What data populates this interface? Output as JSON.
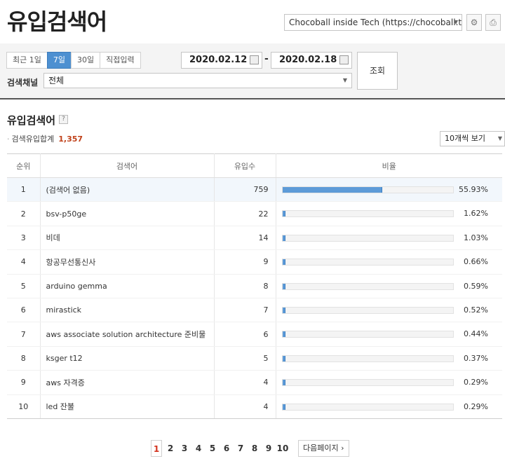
{
  "page": {
    "title": "유입검색어",
    "blog_select": "Chocoball inside Tech (https://chocoball.t⋯",
    "settings_icon": "gear-icon",
    "print_icon": "print-icon"
  },
  "filters": {
    "periods": [
      "최근 1일",
      "7일",
      "30일",
      "직접입력"
    ],
    "active_period": "7일",
    "start_date": "2020.02.12",
    "date_separator": "-",
    "end_date": "2020.02.18",
    "search_label": "조회",
    "channel_label": "검색채널",
    "channel_value": "전체"
  },
  "section": {
    "title": "유입검색어",
    "help": "?",
    "summary_label": "검색유입합계",
    "summary_total": "1,357",
    "per_page": "10개씩 보기"
  },
  "table": {
    "headers": [
      "순위",
      "검색어",
      "유입수",
      "비율"
    ],
    "rows": [
      {
        "rank": "1",
        "term": "(검색어 없음)",
        "count": "759",
        "pct_label": "55.93%",
        "pct": 55.93
      },
      {
        "rank": "2",
        "term": "bsv-p50ge",
        "count": "22",
        "pct_label": "1.62%",
        "pct": 1.62
      },
      {
        "rank": "3",
        "term": "비데",
        "count": "14",
        "pct_label": "1.03%",
        "pct": 1.03
      },
      {
        "rank": "4",
        "term": "항공무선통신사",
        "count": "9",
        "pct_label": "0.66%",
        "pct": 0.66
      },
      {
        "rank": "5",
        "term": "arduino gemma",
        "count": "8",
        "pct_label": "0.59%",
        "pct": 0.59
      },
      {
        "rank": "6",
        "term": "mirastick",
        "count": "7",
        "pct_label": "0.52%",
        "pct": 0.52
      },
      {
        "rank": "7",
        "term": "aws associate solution architecture 준비물",
        "count": "6",
        "pct_label": "0.44%",
        "pct": 0.44
      },
      {
        "rank": "8",
        "term": "ksger t12",
        "count": "5",
        "pct_label": "0.37%",
        "pct": 0.37
      },
      {
        "rank": "9",
        "term": "aws 자격증",
        "count": "4",
        "pct_label": "0.29%",
        "pct": 0.29
      },
      {
        "rank": "10",
        "term": "led 잔불",
        "count": "4",
        "pct_label": "0.29%",
        "pct": 0.29
      }
    ]
  },
  "pagination": {
    "pages": [
      "1",
      "2",
      "3",
      "4",
      "5",
      "6",
      "7",
      "8",
      "9",
      "10"
    ],
    "current": "1",
    "next_label": "다음페이지 ›"
  },
  "colors": {
    "accent": "#4d90d1",
    "bar": "#5d9bd8",
    "total": "#c0421b",
    "current_page": "#d3331f"
  }
}
